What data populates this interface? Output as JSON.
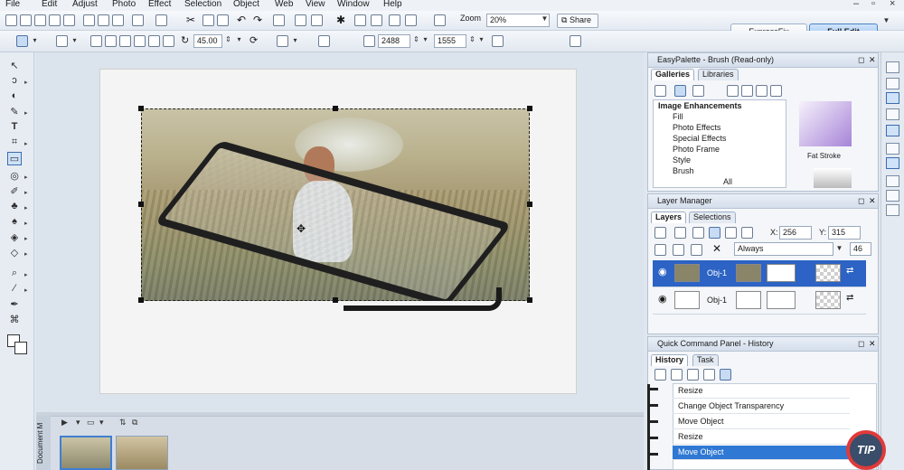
{
  "menu": [
    "File",
    "Edit",
    "Adjust",
    "Photo",
    "Effect",
    "Selection",
    "Object",
    "Web",
    "View",
    "Window",
    "Help"
  ],
  "toolbar": {
    "zoom_label": "Zoom",
    "zoom_value": "20%",
    "share_label": "Share",
    "angle_value": "45.00",
    "width_value": "2488",
    "height_value": "1555"
  },
  "mode": {
    "express_label": "ExpressFix",
    "full_label": "Full Edit"
  },
  "easy_palette": {
    "title": "EasyPalette - Brush (Read-only)",
    "tabs": [
      "Galleries",
      "Libraries"
    ],
    "tree": [
      "Image Enhancements",
      "Fill",
      "Photo Effects",
      "Special Effects",
      "Photo Frame",
      "Style",
      "Brush",
      "All"
    ],
    "preview_label": "Fat Stroke"
  },
  "layer_manager": {
    "title": "Layer Manager",
    "tabs": [
      "Layers",
      "Selections"
    ],
    "x_label": "X:",
    "x_value": "256",
    "y_label": "Y:",
    "y_value": "315",
    "merge_mode": "Always",
    "opacity": "46",
    "layers": [
      "Obj-1",
      "Obj-1"
    ]
  },
  "quick_command": {
    "title": "Quick Command Panel - History",
    "tabs": [
      "History",
      "Task"
    ],
    "items": [
      "Resize",
      "Change Object Transparency",
      "Move Object",
      "Resize",
      "Move Object"
    ]
  },
  "filmstrip": {
    "label": "Document M"
  },
  "logo_text": "TIP"
}
